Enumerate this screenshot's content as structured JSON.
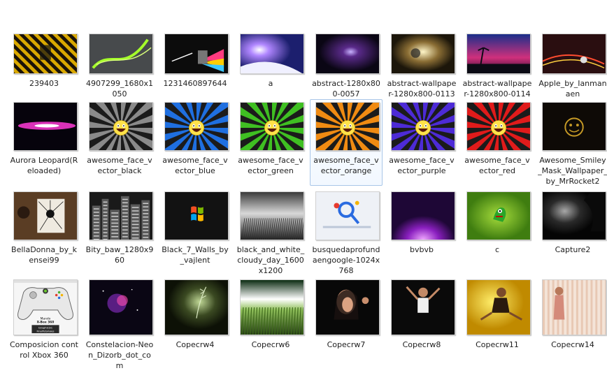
{
  "view": {
    "name": "large-icons-view"
  },
  "files": [
    {
      "name": "239403",
      "art": "hazard-yellow",
      "selected": false
    },
    {
      "name": "4907299_1680x1050",
      "art": "green-swirl",
      "selected": false
    },
    {
      "name": "1231460897644",
      "art": "dark-rainbow",
      "selected": false
    },
    {
      "name": "a",
      "art": "purple-light",
      "selected": false
    },
    {
      "name": "abstract-1280x800-0057",
      "art": "dark-violet",
      "selected": false
    },
    {
      "name": "abstract-wallpaper-1280x800-0113",
      "art": "grunge",
      "selected": false
    },
    {
      "name": "abstract-wallpaper-1280x800-0114",
      "art": "palm-island",
      "selected": false
    },
    {
      "name": "Apple_by_Ianmanaen",
      "art": "apple-dark",
      "selected": false
    },
    {
      "name": "Aurora Leopard(Reloaded)",
      "art": "aurora",
      "selected": false
    },
    {
      "name": "awesome_face_vector_black",
      "art": "face",
      "color": "#8a8a8a",
      "selected": false
    },
    {
      "name": "awesome_face_vector_blue",
      "art": "face",
      "color": "#1f6fe0",
      "selected": false
    },
    {
      "name": "awesome_face_vector_green",
      "art": "face",
      "color": "#3fbf22",
      "selected": false
    },
    {
      "name": "awesome_face_vector_orange",
      "art": "face",
      "color": "#f08b12",
      "selected": true
    },
    {
      "name": "awesome_face_vector_purple",
      "art": "face",
      "color": "#4d2bd6",
      "selected": false
    },
    {
      "name": "awesome_face_vector_red",
      "art": "face",
      "color": "#e01b1b",
      "selected": false
    },
    {
      "name": "Awesome_Smiley_Mask_Wallpaper_by_MrRocket2",
      "art": "smiley-mask",
      "selected": false
    },
    {
      "name": "BellaDonna_by_kensei99",
      "art": "belladonna",
      "selected": false
    },
    {
      "name": "Bity_baw_1280x960",
      "art": "city-bw",
      "selected": false
    },
    {
      "name": "Black_7_Walls_by_vajlent",
      "art": "windows7",
      "selected": false
    },
    {
      "name": "black_and_white_cloudy_day_1600x1200",
      "art": "field-bw",
      "selected": false
    },
    {
      "name": "busquedaprofundaengoogle-1024x768",
      "art": "google-blue",
      "selected": false
    },
    {
      "name": "bvbvb",
      "art": "purple-rays",
      "selected": false
    },
    {
      "name": "c",
      "art": "green-monster",
      "selected": false
    },
    {
      "name": "Capture2",
      "art": "dark-figure",
      "selected": false
    },
    {
      "name": "Composicion control Xbox 360",
      "art": "xbox",
      "selected": false
    },
    {
      "name": "Constelacion-Neon_Dizorb_dot_com",
      "art": "neon-space",
      "selected": false
    },
    {
      "name": "Copecrw4",
      "art": "grass-dark",
      "selected": false
    },
    {
      "name": "Copecrw6",
      "art": "wheat-sky",
      "selected": false
    },
    {
      "name": "Copecrw7",
      "art": "portrait-dark",
      "selected": false
    },
    {
      "name": "Copecrw8",
      "art": "dancer-dark",
      "selected": false
    },
    {
      "name": "Copecrw11",
      "art": "woman-yellow",
      "selected": false
    },
    {
      "name": "Copecrw14",
      "art": "woman-curtain",
      "selected": false
    }
  ],
  "xbox_thumb_text": {
    "line1": "Mando",
    "line2": "X-Box 360",
    "line3": "GraphicSC",
    "line4": "FinalTutoriales"
  }
}
